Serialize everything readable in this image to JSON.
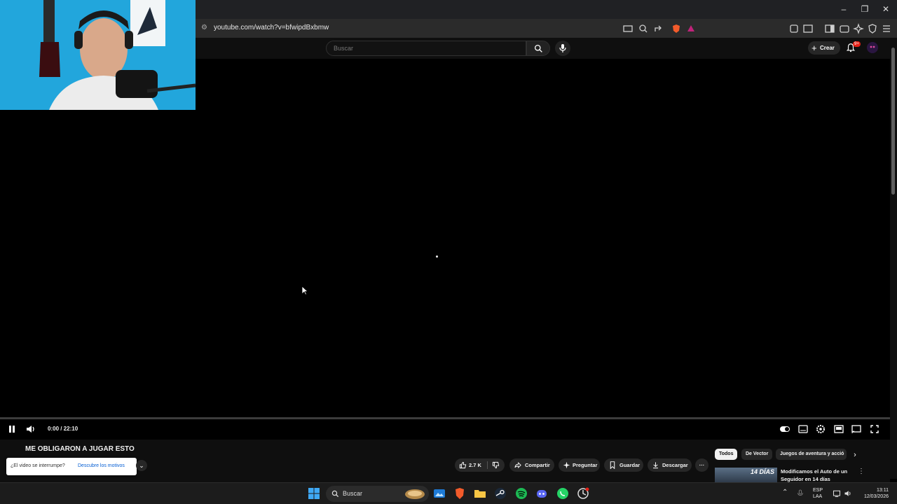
{
  "window": {
    "controls": {
      "minimize": "–",
      "maximize": "❐",
      "close": "✕"
    }
  },
  "browser": {
    "url": "youtube.com/watch?v=bfwipdBxbmw",
    "extension_icons": [
      "cast-icon",
      "zoom-icon",
      "share-icon",
      "brave-shields-icon",
      "brave-rewards-icon",
      "extensions-icon",
      "tab-search-icon",
      "sidebar-icon",
      "wallet-icon",
      "leo-ai-icon",
      "vpn-icon",
      "menu-icon"
    ]
  },
  "youtube": {
    "search_placeholder": "Buscar",
    "create_label": "Crear",
    "notifications_badge": "9+",
    "accent_color": "#ff0000"
  },
  "player": {
    "time": "0:00 / 22:10",
    "progress_fraction": 0.0
  },
  "video": {
    "title": "ME OBLIGARON A JUGAR ESTO",
    "interruption_question": "¿El video se interrumpe?",
    "interruption_link": "Descubre los motivos",
    "actions": {
      "likes": "2.7 K",
      "share": "Compartir",
      "ask": "Preguntar",
      "save": "Guardar",
      "download": "Descargar"
    }
  },
  "sidebar": {
    "chips": [
      "Todos",
      "De Vector",
      "Juegos de aventura y acció"
    ],
    "recommended": {
      "title": "Modificamos el Auto de un Seguidor en 14 días",
      "thumb_text": "14 DÍAS"
    }
  },
  "taskbar": {
    "search_label": "Buscar",
    "language": "ESP",
    "layout": "LAA",
    "time": "13:11",
    "date": "12/03/2026"
  }
}
